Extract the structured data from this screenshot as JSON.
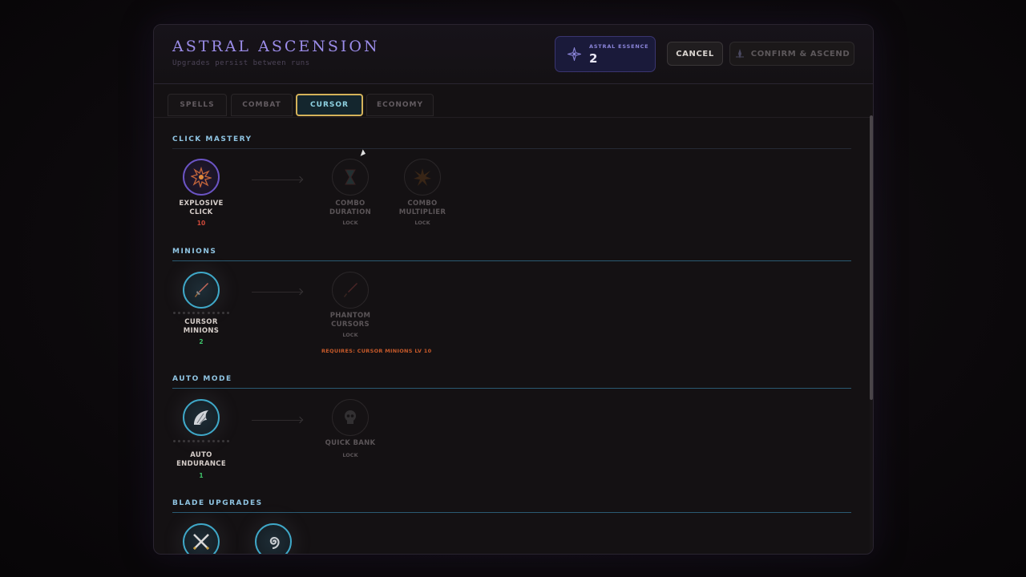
{
  "header": {
    "title": "ASTRAL ASCENSION",
    "subtitle": "Upgrades persist between runs",
    "essence_label": "ASTRAL ESSENCE",
    "essence_value": "2",
    "cancel_label": "CANCEL",
    "confirm_label": "CONFIRM & ASCEND"
  },
  "tabs": [
    {
      "label": "SPELLS",
      "active": false
    },
    {
      "label": "COMBAT",
      "active": false
    },
    {
      "label": "CURSOR",
      "active": true
    },
    {
      "label": "ECONOMY",
      "active": false
    }
  ],
  "sections": {
    "click_mastery": {
      "title": "CLICK MASTERY",
      "nodes": [
        {
          "name": "EXPLOSIVE CLICK",
          "line1": "EXPLOSIVE",
          "line2": "CLICK",
          "level": "10",
          "icon": "explosion-icon"
        },
        {
          "name": "COMBO DURATION",
          "line1": "COMBO",
          "line2": "DURATION",
          "level": "LOCK",
          "icon": "hourglass-icon"
        },
        {
          "name": "COMBO MULTIPLIER",
          "line1": "COMBO",
          "line2": "MULTIPLIER",
          "level": "LOCK",
          "icon": "burst-icon"
        }
      ]
    },
    "minions": {
      "title": "MINIONS",
      "nodes": [
        {
          "name": "CURSOR MINIONS",
          "line1": "CURSOR",
          "line2": "MINIONS",
          "level": "2",
          "icon": "sword-icon"
        },
        {
          "name": "PHANTOM CURSORS",
          "line1": "PHANTOM",
          "line2": "CURSORS",
          "level": "LOCK",
          "icon": "sword-icon"
        }
      ],
      "requirement": "REQUIRES: CURSOR MINIONS LV 10"
    },
    "auto_mode": {
      "title": "AUTO MODE",
      "nodes": [
        {
          "name": "AUTO ENDURANCE",
          "line1": "AUTO",
          "line2": "ENDURANCE",
          "level": "1",
          "icon": "wing-icon"
        },
        {
          "name": "QUICK BANK",
          "line1": "QUICK BANK",
          "line2": "",
          "level": "LOCK",
          "icon": "skull-icon"
        }
      ]
    },
    "blade_upgrades": {
      "title": "BLADE UPGRADES",
      "nodes": [
        {
          "name": "CROSSED BLADES",
          "icon": "crossed-swords-icon"
        },
        {
          "name": "SPIRAL",
          "icon": "spiral-icon"
        }
      ]
    }
  },
  "colors": {
    "accent_purple": "#9b8ce8",
    "accent_cyan": "#8fc4e2",
    "active_tab_border": "#d4b25a",
    "level_red": "#d04a3a",
    "level_green": "#3ec46a",
    "requirement_orange": "#c75a2a"
  }
}
